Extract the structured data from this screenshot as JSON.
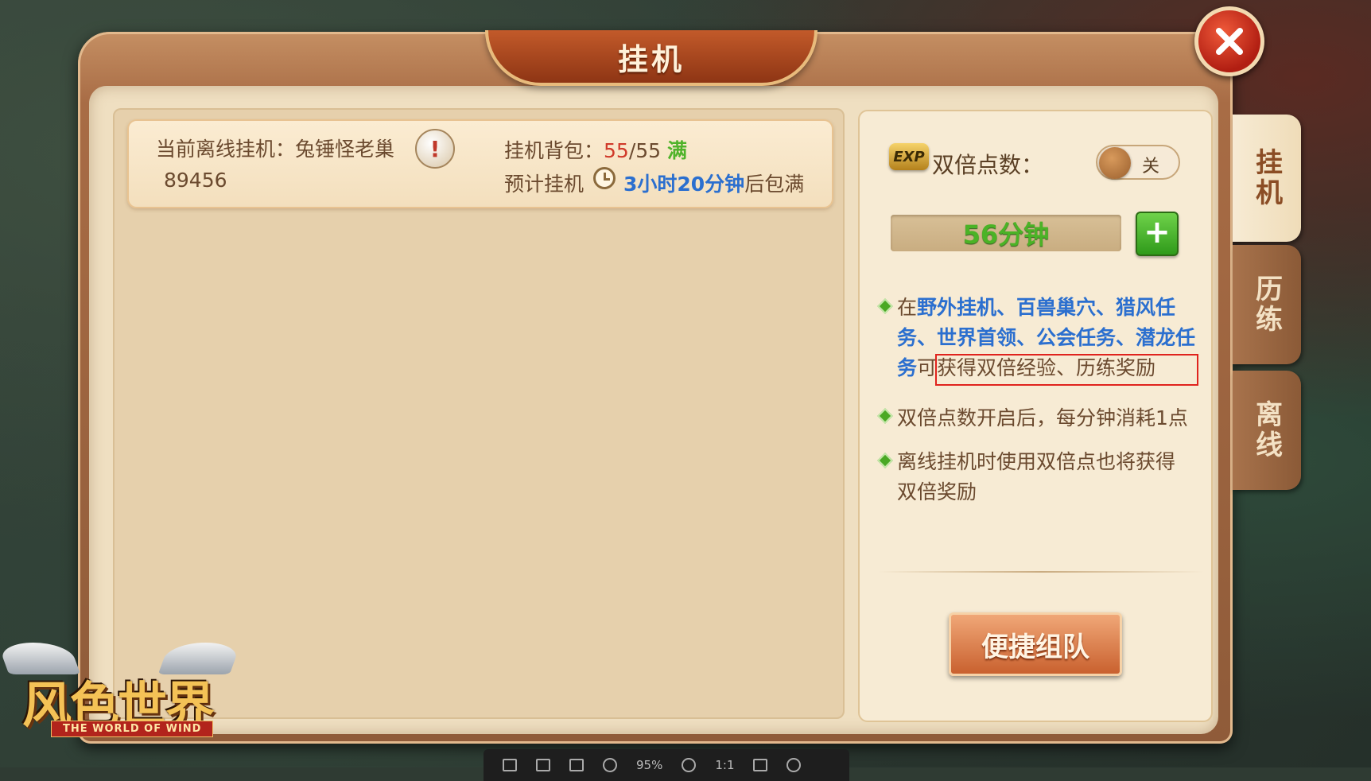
{
  "window": {
    "title": "挂机"
  },
  "status": {
    "current_label": "当前离线挂机：兔锤怪老巢",
    "value": "89456",
    "bag_label": "挂机背包：",
    "bag_current": "55",
    "bag_max": "/55",
    "bag_full_tag": "满",
    "eta_label": "预计挂机",
    "eta_value": "3小时20分钟",
    "eta_suffix": "后包满"
  },
  "double": {
    "label": "双倍点数：",
    "icon": "exp-icon",
    "toggle_label": "关",
    "toggle_on": false,
    "minutes": "56分钟"
  },
  "tips": [
    {
      "part1": "在",
      "highlight": "野外挂机、百兽巢穴、猎风任务、世界首领、公会任务、潜龙任务",
      "part2": "可获得双倍经验、历练奖励"
    },
    {
      "text": "双倍点数开启后，每分钟消耗1点"
    },
    {
      "text": "离线挂机时使用双倍点也将获得双倍奖励"
    }
  ],
  "buttons": {
    "team": "便捷组队"
  },
  "tabs": [
    {
      "label": "挂机",
      "active": true
    },
    {
      "label": "历练",
      "active": false
    },
    {
      "label": "离线",
      "active": false
    }
  ],
  "logo": {
    "main": "风色世界",
    "sub": "THE WORLD OF WIND"
  },
  "viewer": {
    "zoom": "95%",
    "ratio": "1:1"
  },
  "colors": {
    "accent_blue": "#2b6fcf",
    "accent_red": "#d03a2a",
    "accent_green": "#4bb326"
  }
}
